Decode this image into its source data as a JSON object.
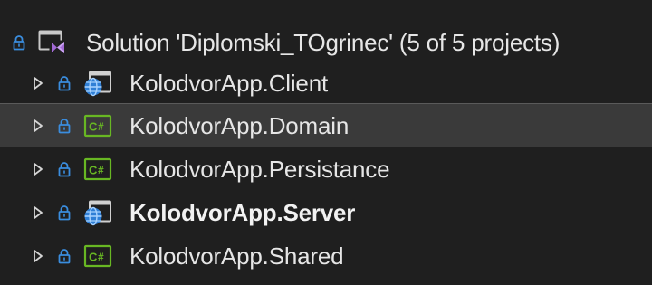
{
  "solution": {
    "label": "Solution 'Diplomski_TOgrinec' (5 of 5 projects)",
    "icon": "solution-icon",
    "lock_icon": "lock-icon"
  },
  "projects": [
    {
      "label": "KolodvorApp.Client",
      "icon": "web-project-icon",
      "bold": false,
      "selected": false
    },
    {
      "label": "KolodvorApp.Domain",
      "icon": "csharp-project-icon",
      "bold": false,
      "selected": true
    },
    {
      "label": "KolodvorApp.Persistance",
      "icon": "csharp-project-icon",
      "bold": false,
      "selected": false
    },
    {
      "label": "KolodvorApp.Server",
      "icon": "web-project-icon",
      "bold": true,
      "selected": false
    },
    {
      "label": "KolodvorApp.Shared",
      "icon": "csharp-project-icon",
      "bold": false,
      "selected": false
    }
  ],
  "colors": {
    "background": "#1f1f1f",
    "selection": "#3a3a3a",
    "lock": "#3a8dde",
    "csharp_green": "#68b723",
    "web_blue": "#2f7fd6"
  }
}
